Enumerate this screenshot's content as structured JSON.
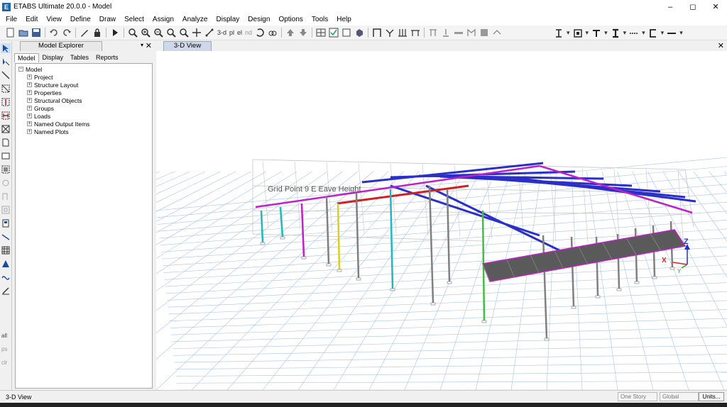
{
  "window": {
    "title": "ETABS Ultimate 20.0.0 - Model",
    "app_icon_letter": "E",
    "minimize": "–",
    "maximize": "◻",
    "close": "✕"
  },
  "menu": [
    "File",
    "Edit",
    "View",
    "Define",
    "Draw",
    "Select",
    "Assign",
    "Analyze",
    "Display",
    "Design",
    "Options",
    "Tools",
    "Help"
  ],
  "toolbar": {
    "label_3d": "3-d",
    "label_plan": "pl",
    "label_elev": "el",
    "label_nd": "nd"
  },
  "explorer": {
    "title": "Model Explorer",
    "pin": "▾",
    "close": "✕",
    "tabs": [
      "Model",
      "Display",
      "Tables",
      "Reports"
    ],
    "root": "Model",
    "items": [
      "Project",
      "Structure Layout",
      "Properties",
      "Structural Objects",
      "Groups",
      "Loads",
      "Named Output Items",
      "Named Plots"
    ]
  },
  "view": {
    "tab_label": "3-D View",
    "close": "✕",
    "hover_label": "Grid Point  9  E  Eave Height",
    "axis_z": "Z",
    "axis_x": "X",
    "axis_y": "Y"
  },
  "status": {
    "text": "3-D View",
    "story_select": "One Story",
    "coord_select": "Global",
    "units_button": "Units..."
  },
  "colors": {
    "grid": "#a9c4e6",
    "frame_gray": "#c4c4c4",
    "beam_blue": "#2a2fc8",
    "col_magenta": "#c020c8",
    "col_cyan": "#20b8c0",
    "col_yellow": "#d8d020",
    "col_green": "#40c040",
    "beam_red": "#d02020",
    "col_gray": "#808080"
  }
}
